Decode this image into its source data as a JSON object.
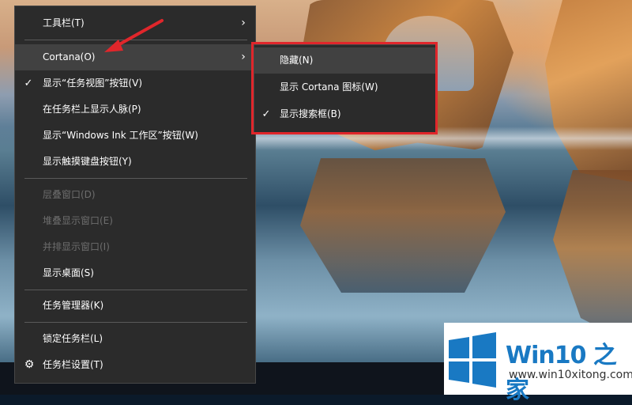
{
  "context_menu": {
    "items": [
      {
        "label": "工具栏(T)"
      },
      {
        "label": "Cortana(O)"
      },
      {
        "label": "显示“任务视图”按钮(V)"
      },
      {
        "label": "在任务栏上显示人脉(P)"
      },
      {
        "label": "显示“Windows Ink 工作区”按钮(W)"
      },
      {
        "label": "显示触摸键盘按钮(Y)"
      },
      {
        "label": "层叠窗口(D)"
      },
      {
        "label": "堆叠显示窗口(E)"
      },
      {
        "label": "并排显示窗口(I)"
      },
      {
        "label": "显示桌面(S)"
      },
      {
        "label": "任务管理器(K)"
      },
      {
        "label": "锁定任务栏(L)"
      },
      {
        "label": "任务栏设置(T)"
      }
    ],
    "submenu_glyph": "›",
    "check_glyph": "✓",
    "gear_glyph": "⚙"
  },
  "cortana_submenu": {
    "items": [
      {
        "label": "隐藏(N)"
      },
      {
        "label": "显示 Cortana 图标(W)"
      },
      {
        "label": "显示搜索框(B)"
      }
    ]
  },
  "watermark": {
    "title_a": "Win10",
    "title_b": " 之家",
    "url": "www.win10xitong.com"
  },
  "colors": {
    "menu_bg": "#2b2b2b",
    "hover_bg": "#414141",
    "highlight_red": "#e0262b",
    "logo_blue": "#1979c3"
  }
}
